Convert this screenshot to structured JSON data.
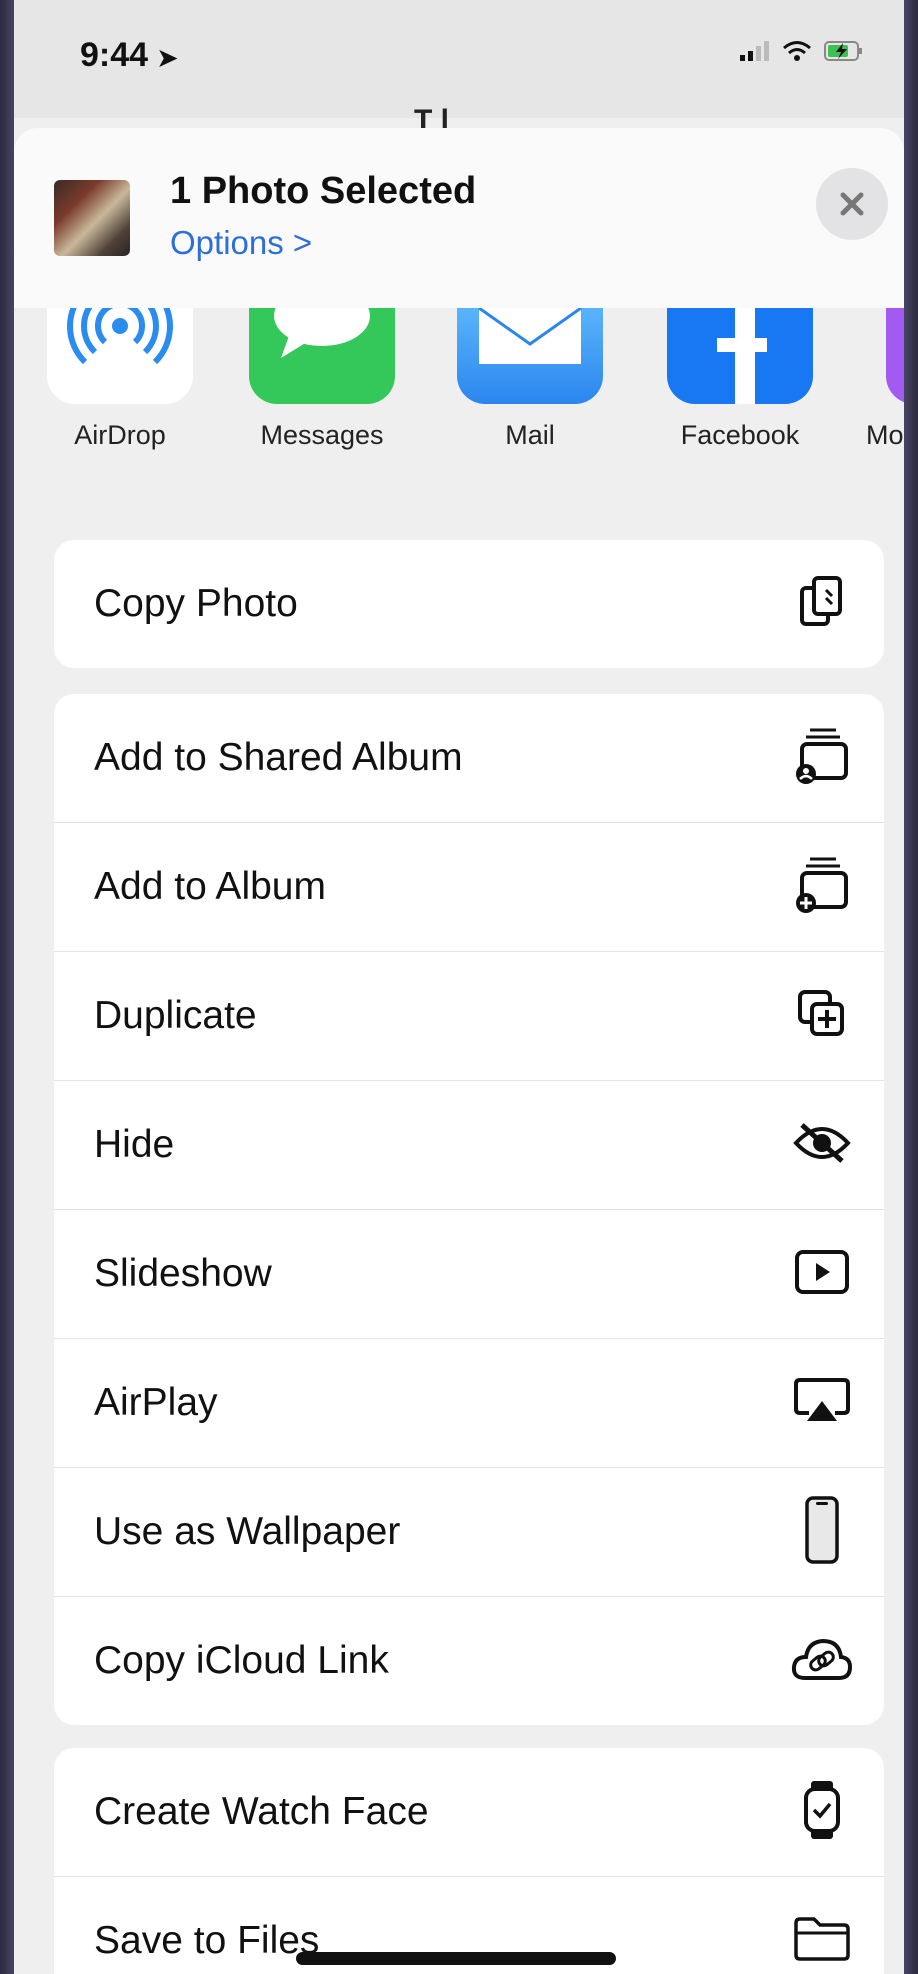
{
  "status": {
    "time": "9:44"
  },
  "behind_title": "T  l",
  "header": {
    "title": "1 Photo Selected",
    "options": "Options >"
  },
  "apps": [
    {
      "label": "AirDrop"
    },
    {
      "label": "Messages"
    },
    {
      "label": "Mail"
    },
    {
      "label": "Facebook"
    },
    {
      "label": "Mo"
    }
  ],
  "groups": [
    {
      "rows": [
        {
          "label": "Copy Photo",
          "icon": "copy-icon"
        }
      ]
    },
    {
      "rows": [
        {
          "label": "Add to Shared Album",
          "icon": "shared-album-icon"
        },
        {
          "label": "Add to Album",
          "icon": "add-album-icon"
        },
        {
          "label": "Duplicate",
          "icon": "duplicate-icon"
        },
        {
          "label": "Hide",
          "icon": "eye-slash-icon"
        },
        {
          "label": "Slideshow",
          "icon": "play-icon"
        },
        {
          "label": "AirPlay",
          "icon": "airplay-icon"
        },
        {
          "label": "Use as Wallpaper",
          "icon": "phone-icon"
        },
        {
          "label": "Copy iCloud Link",
          "icon": "cloud-link-icon"
        }
      ]
    },
    {
      "rows": [
        {
          "label": "Create Watch Face",
          "icon": "watch-icon"
        },
        {
          "label": "Save to Files",
          "icon": "folder-icon"
        }
      ]
    }
  ],
  "colors": {
    "accent": "#2d6fd6",
    "messages": "#34c759",
    "mail": "#3d9bf5",
    "facebook": "#1877f2"
  }
}
